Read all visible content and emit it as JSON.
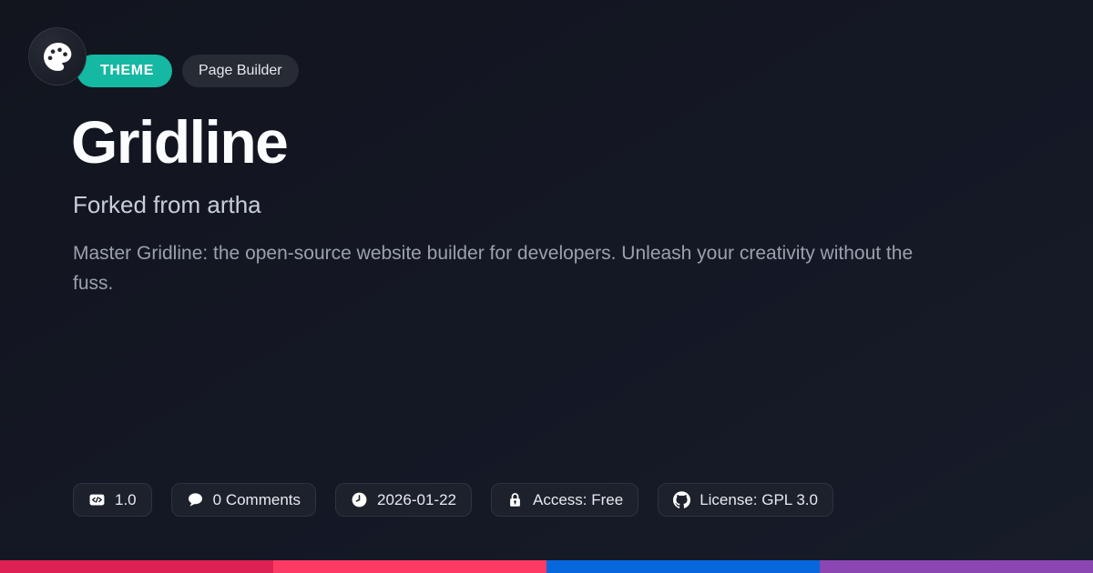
{
  "colors": {
    "background_top": "#12151e",
    "background_bottom": "#171c29",
    "theme_badge_bg": "#15b8a3",
    "category_badge_bg": "#272b34",
    "chip_bg": "#1c212c",
    "chip_border": "#2c3342",
    "title_color": "#fbfcfd",
    "subtitle_color": "#c7ceda",
    "description_color": "#9aa1ad"
  },
  "header": {
    "logo_icon": "palette-icon",
    "type_badge_label": "THEME",
    "category_badge_label": "Page Builder"
  },
  "hero": {
    "title": "Gridline",
    "subtitle": "Forked from artha",
    "description": "Master Gridline: the open-source website builder for developers. Unleash your creativity without the fuss."
  },
  "meta_badges": [
    {
      "icon": "code-window-icon",
      "label": "1.0"
    },
    {
      "icon": "comment-icon",
      "label": "0 Comments"
    },
    {
      "icon": "clock-icon",
      "label": "2026-01-22"
    },
    {
      "icon": "lock-icon",
      "label": "Access: Free"
    },
    {
      "icon": "github-icon",
      "label": "License: GPL 3.0"
    }
  ],
  "footer": {
    "stripe_colors": [
      "#de2154",
      "#fc3a63",
      "#0768de",
      "#8c46b4"
    ]
  }
}
